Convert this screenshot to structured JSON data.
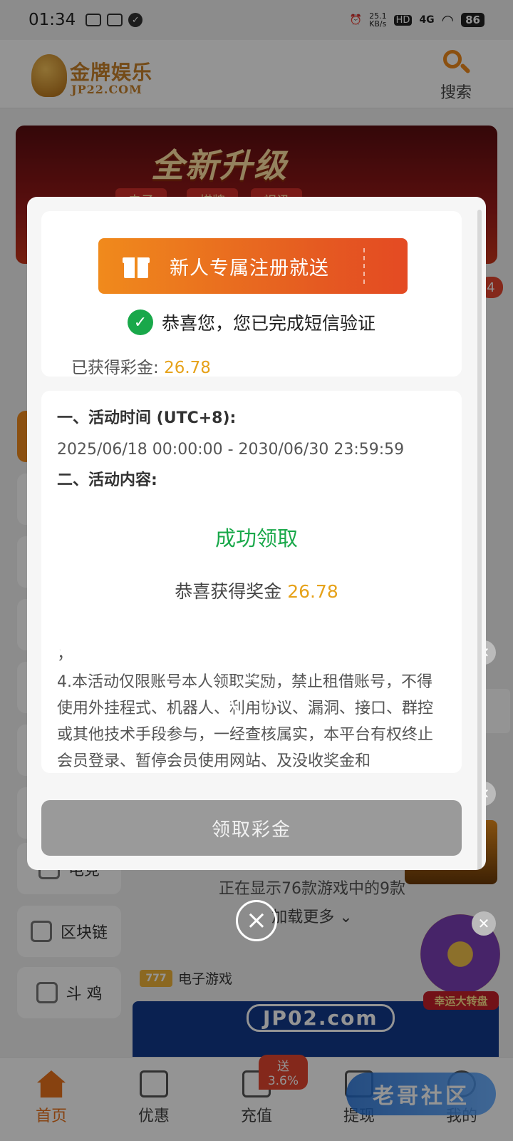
{
  "status_bar": {
    "time": "01:34",
    "net_speed": "25.1\nKB/s",
    "hd": "HD",
    "signal": "4G",
    "battery": "86"
  },
  "header": {
    "logo_cn": "金牌娱乐",
    "logo_en": "JP22.COM",
    "search_label": "搜索"
  },
  "banner": {
    "title": "全新升级",
    "tags": [
      "电子",
      "棋牌",
      "视讯"
    ]
  },
  "side_nav": {
    "items": [
      {
        "label": "电竞"
      },
      {
        "label": "区块链"
      },
      {
        "label": "斗 鸡"
      }
    ]
  },
  "games": {
    "count_text": "正在显示76款游戏中的9款",
    "load_more": "加载更多",
    "section_label": "电子游戏",
    "promo_text": "JP02.com",
    "badge_count": "4",
    "wheel_label": "幸运大转盘"
  },
  "bottom_nav": {
    "items": [
      {
        "label": "首页"
      },
      {
        "label": "优惠"
      },
      {
        "label": "充值"
      },
      {
        "label": "提现"
      },
      {
        "label": "我的"
      }
    ],
    "recharge_badge": "送3.6%"
  },
  "watermark": "老哥社区",
  "modal": {
    "ticket_text": "新人专属注册就送",
    "verify_text": "恭喜您，您已完成短信验证",
    "bonus_label": "已获得彩金:",
    "bonus_value": "26.78",
    "rules": {
      "h1": "一、活动时间 (UTC+8):",
      "period": "2025/06/18 00:00:00 - 2030/06/30 23:59:59",
      "h2": "二、活动内容:",
      "semicolon": "；",
      "para4": "4.本活动仅限账号本人领取奖励，禁止租借账号，不得使用外挂程式、机器人、利用协议、漏洞、接口、群控或其他技术手段参与，一经查核属实，本平台有权终止会员登录、暂停会员使用网站、及没收奖金和"
    },
    "claim_button": "领取彩金"
  },
  "success_dialog": {
    "title": "成功领取",
    "message_prefix": "恭喜获得奖金",
    "amount": "26.78"
  },
  "colors": {
    "accent": "#f08a1c",
    "success_green": "#19a84a",
    "gold": "#e6a21a",
    "disabled_button": "#9a9a9a"
  }
}
